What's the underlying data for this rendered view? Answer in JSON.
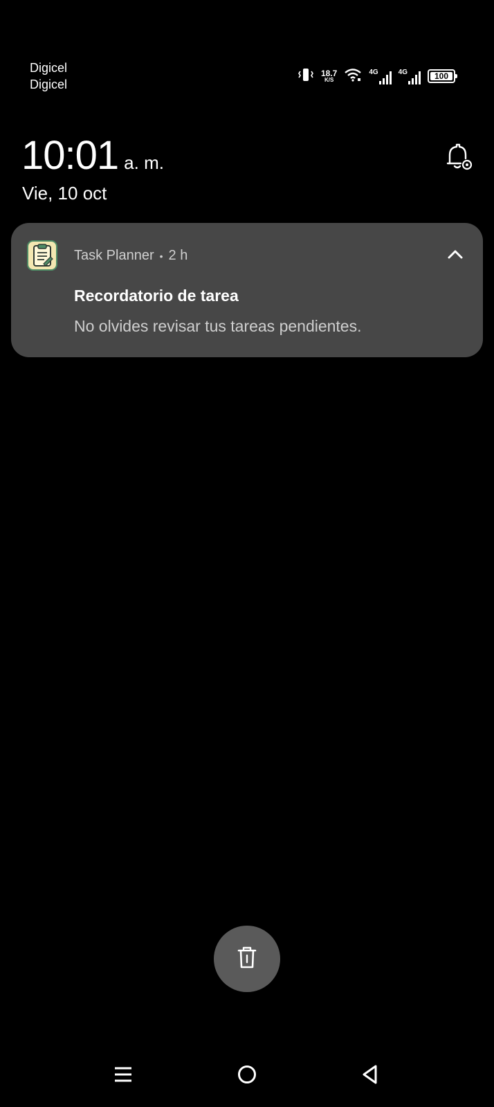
{
  "status_bar": {
    "carrier_1": "Digicel",
    "carrier_2": "Digicel",
    "speed_value": "18.7",
    "speed_unit": "K/S",
    "net_1": "4G",
    "net_2": "4G",
    "battery_level": "100",
    "icons": [
      "vibrate-icon",
      "wifi-icon",
      "signal-icon",
      "signal-icon",
      "battery-icon"
    ]
  },
  "lock": {
    "time": "10:01",
    "ampm": "a. m.",
    "date": "Vie, 10 oct",
    "icon": "notification-settings-icon"
  },
  "notification": {
    "app_name": "Task Planner",
    "separator": "•",
    "age": "2 h",
    "title": "Recordatorio de tarea",
    "body": "No olvides revisar tus tareas pendientes.",
    "icons": [
      "task-planner-app-icon",
      "chevron-up-icon"
    ]
  },
  "actions": {
    "clear_icon": "trash-icon"
  },
  "nav_bar": {
    "icons": [
      "menu-icon",
      "home-icon",
      "back-icon"
    ]
  },
  "colors": {
    "background": "#000000",
    "card": "#474747",
    "clear_button": "#5a5a5a",
    "app_icon_bg": "#f3e7b1",
    "app_icon_accent": "#4f8c66"
  }
}
